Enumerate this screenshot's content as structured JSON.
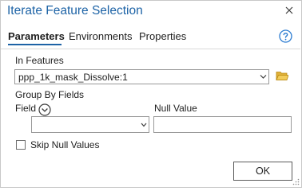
{
  "dialog": {
    "title": "Iterate Feature Selection"
  },
  "tabs": [
    {
      "label": "Parameters",
      "active": true
    },
    {
      "label": "Environments",
      "active": false
    },
    {
      "label": "Properties",
      "active": false
    }
  ],
  "params": {
    "in_features_label": "In Features",
    "in_features_value": "ppp_1k_mask_Dissolve:1",
    "group_by_label": "Group By Fields",
    "field_label": "Field",
    "null_value_label": "Null Value",
    "field_value": "",
    "null_value": "",
    "skip_null_label": "Skip Null Values",
    "skip_null_checked": false
  },
  "buttons": {
    "ok_label": "OK"
  },
  "colors": {
    "accent": "#1d63a6",
    "folder": "#d9a21b"
  },
  "icons": {
    "close": "close-icon",
    "help": "help-icon",
    "dropdown": "chevron-down-icon",
    "browse": "folder-icon",
    "expand": "expand-circle-icon",
    "resize": "resize-grip-icon"
  }
}
